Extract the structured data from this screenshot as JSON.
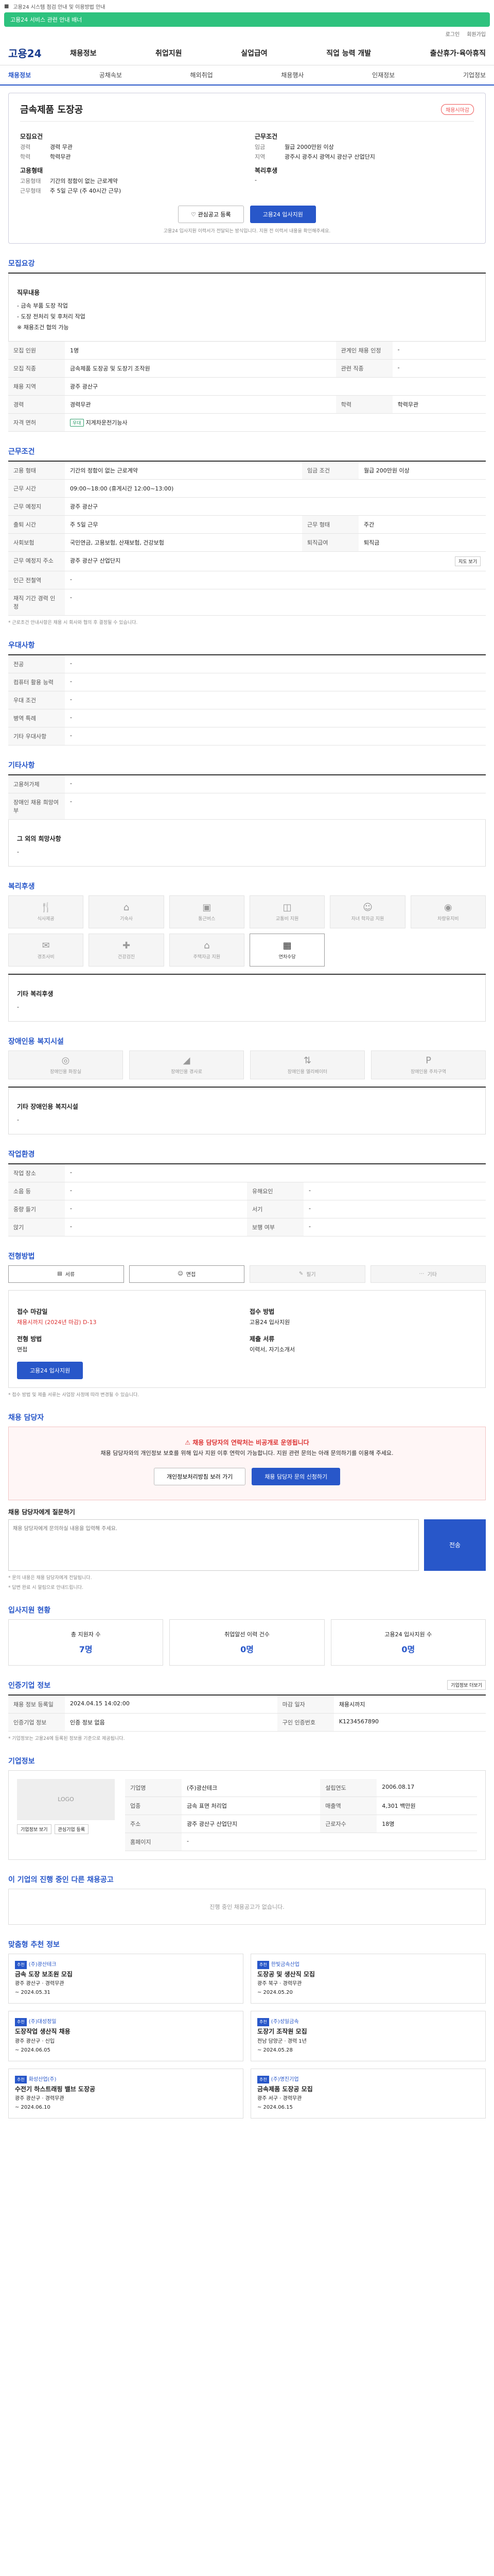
{
  "topbar": {
    "notice": "고용24 시스템 점검 안내 및 이용방법 안내"
  },
  "banner": {
    "text": "고용24 서비스 관련 안내 배너"
  },
  "util": [
    "로그인",
    "회원가입"
  ],
  "gnb": {
    "logo": "고용24",
    "menu": [
      "채용정보",
      "취업지원",
      "실업급여",
      "직업 능력 개발",
      "출산휴가·육아휴직"
    ]
  },
  "subnav": [
    "채용정보",
    "공채속보",
    "해외취업",
    "채용행사",
    "인재정보",
    "기업정보"
  ],
  "job": {
    "title": "금속제품 도장공",
    "status": "채용시마감",
    "left": [
      {
        "label": "모집요건",
        "items": [
          {
            "k": "경력",
            "v": "경력 무관"
          },
          {
            "k": "학력",
            "v": "학력무관"
          }
        ]
      },
      {
        "label": "고용형태",
        "items": [
          {
            "k": "고용형태",
            "v": "기간의 정함이 없는 근로계약"
          },
          {
            "k": "근무형태",
            "v": "주 5일 근무 (주 40시간 근무)"
          }
        ]
      }
    ],
    "right": [
      {
        "label": "근무조건",
        "items": [
          {
            "k": "임금",
            "v": "월급 2000만원 이상"
          },
          {
            "k": "지역",
            "v": "광주시 광주시 광역시 광산구 산업단지"
          }
        ]
      },
      {
        "label": "복리후생",
        "items": [
          {
            "k": "",
            "v": "-"
          }
        ]
      }
    ],
    "cta_secondary": "관심공고 등록",
    "cta_primary": "고용24 입사지원",
    "note": "고용24 입사지원 이력서가 전달되는 방식입니다. 지원 전 이력서 내용을 확인해주세요."
  },
  "sections": {
    "recruit": "모집요강",
    "work": "근무조건",
    "pref": "우대사항",
    "other": "기타사항",
    "welfare": "복리후생",
    "disabled": "장애인용 복지시설",
    "office": "작업환경",
    "method": "전형방법",
    "contact": "채용 담당자",
    "history": "입사지원 현황",
    "reg": "인증기업 정보",
    "company": "기업정보",
    "same": "이 기업의 진행 중인 다른 채용공고",
    "recommend": "맞춤형 추천 정보"
  },
  "recruit": {
    "duty_label": "직무내용",
    "duty_lines": [
      "- 금속 부품 도장 작업",
      "- 도장 전처리 및 후처리 작업",
      "※ 채용조건 협의 가능"
    ],
    "rows": [
      [
        "모집 인원",
        "1명",
        "관계인 채용 인정",
        "-"
      ],
      [
        "모집 직종",
        "금속제품 도장공 및 도장기 조작원",
        "관련 직종",
        "-"
      ],
      [
        "채용 지역",
        "광주 광산구",
        "",
        ""
      ],
      [
        "경력",
        "경력무관",
        "학력",
        "학력무관"
      ],
      [
        "자격 면허",
        "지게차운전기능사",
        "",
        ""
      ]
    ],
    "license_tag": "우대"
  },
  "work": {
    "rows": [
      [
        "고용 형태",
        "기간의 정함이 없는 근로계약",
        "임금 조건",
        "월급 200만원 이상"
      ],
      [
        "근무 시간",
        "09:00~18:00 (휴게시간 12:00~13:00)",
        "",
        ""
      ],
      [
        "근무 예정지",
        "광주 광산구",
        "",
        ""
      ],
      [
        "출퇴 시간",
        "주 5일 근무",
        "근무 형태",
        "주간"
      ],
      [
        "사회보험",
        "국민연금, 고용보험, 산재보험, 건강보험",
        "퇴직급여",
        "퇴직금"
      ],
      [
        "근무 예정지 주소",
        "광주 광산구 산업단지",
        "",
        ""
      ],
      [
        "인근 전철역",
        "-",
        "",
        ""
      ],
      [
        "재직 기간 경력 인정",
        "-",
        "",
        ""
      ]
    ],
    "map_btn": "지도 보기",
    "footnote": "* 근로조건 안내사항은 채용 시 회사와 협의 후 결정될 수 있습니다."
  },
  "pref": {
    "rows": [
      [
        "전공",
        "-"
      ],
      [
        "컴퓨터 활용 능력",
        "-"
      ],
      [
        "우대 조건",
        "-"
      ],
      [
        "병역 특례",
        "-"
      ],
      [
        "기타 우대사항",
        "-"
      ]
    ]
  },
  "other": {
    "rows": [
      [
        "고용허가제",
        "-"
      ],
      [
        "장애인 채용 희망여부",
        "-"
      ]
    ],
    "extra_label": "그 외의 희망사항",
    "extra": "-"
  },
  "welfare": {
    "items": [
      "식사제공",
      "기숙사",
      "통근버스",
      "교통비 지원",
      "자녀 학자금 지원",
      "차량유지비",
      "경조사비",
      "건강검진",
      "주택자금 지원",
      "연차수당"
    ],
    "extra_label": "기타 복리후생",
    "extra": "-"
  },
  "disabled": {
    "items": [
      "장애인용 화장실",
      "장애인용 경사로",
      "장애인용 엘리베이터",
      "장애인용 주차구역"
    ],
    "extra_label": "기타 장애인용 복지시설",
    "extra": "-"
  },
  "office": {
    "rows": [
      [
        "작업 장소",
        "-",
        "",
        ""
      ],
      [
        "소음 등",
        "-",
        "유해요인",
        "-"
      ],
      [
        "중량 들기",
        "-",
        "서기",
        "-"
      ],
      [
        "앉기",
        "-",
        "보행 여부",
        "-"
      ]
    ]
  },
  "method": {
    "items": [
      "서류",
      "면접",
      "필기",
      "기타"
    ],
    "rows": [
      [
        "접수 마감일",
        "채용시까지 (2024년 마감) D-13"
      ],
      [
        "접수 방법",
        "고용24 입사지원"
      ],
      [
        "전형 방법",
        "면접"
      ],
      [
        "제출 서류",
        "이력서, 자기소개서"
      ]
    ],
    "apply_btn": "고용24 입사지원",
    "footnote": "* 접수 방법 및 제출 서류는 사업장 사정에 따라 변경될 수 있습니다."
  },
  "contact": {
    "alert_title": "채용 담당자의 연락처는 비공개로 운영됩니다",
    "alert_body": "채용 담당자와의 개인정보 보호를 위해 입사 지원 이후 연락이 가능합니다. 지원 관련 문의는 아래 문의하기를 이용해 주세요.",
    "btn1": "개인정보처리방침 보러 가기",
    "btn2": "채용 담당자 문의 신청하기",
    "ask_label": "채용 담당자에게 질문하기",
    "ask_placeholder": "채용 담당자에게 문의하실 내용을 입력해 주세요.",
    "ask_btn": "전송",
    "notes": [
      "* 문의 내용은 채용 담당자에게 전달됩니다.",
      "* 답변 완료 시 알림으로 안내드립니다."
    ]
  },
  "history": {
    "items": [
      {
        "label": "총 지원자 수",
        "value": "7명"
      },
      {
        "label": "취업알선 이력 건수",
        "value": "0명"
      },
      {
        "label": "고용24 입사지원 수",
        "value": "0명"
      }
    ]
  },
  "reg": {
    "btn": "기업정보 더보기",
    "rows": [
      [
        "채용 정보 등록일",
        "2024.04.15 14:02:00",
        "마감 일자",
        "채용시까지"
      ],
      [
        "인증기업 정보",
        "인증 정보 없음",
        "구인 인증번호",
        "K1234567890"
      ]
    ],
    "footnote": "* 기업정보는 고용24에 등록된 정보를 기준으로 제공됩니다."
  },
  "company": {
    "logo": "LOGO",
    "rows": [
      [
        "기업명",
        "(주)광산테크",
        "설립연도",
        "2006.08.17"
      ],
      [
        "업종",
        "금속 표면 처리업",
        "매출액",
        "4,301 백만원"
      ],
      [
        "주소",
        "광주 광산구 산업단지",
        "근로자수",
        "18명"
      ],
      [
        "홈페이지",
        "-",
        "",
        ""
      ]
    ],
    "btns": [
      "기업정보 보기",
      "관심기업 등록"
    ]
  },
  "same": {
    "empty": "진행 중인 채용공고가 없습니다."
  },
  "recommend": {
    "items": [
      {
        "badge": "추천",
        "company": "(주)광산테크",
        "title": "금속 도장 보조원 모집",
        "meta": "광주 광산구 · 경력무관",
        "date": "~ 2024.05.31"
      },
      {
        "badge": "추천",
        "company": "한빛금속산업",
        "title": "도장공 및 생산직 모집",
        "meta": "광주 북구 · 경력무관",
        "date": "~ 2024.05.20"
      },
      {
        "badge": "추천",
        "company": "(주)대성정밀",
        "title": "도장작업 생산직 채용",
        "meta": "광주 광산구 · 신입",
        "date": "~ 2024.06.05"
      },
      {
        "badge": "추천",
        "company": "(주)성일금속",
        "title": "도장기 조작원 모집",
        "meta": "전남 담양군 · 경력 1년",
        "date": "~ 2024.05.28"
      },
      {
        "badge": "추천",
        "company": "화성산업(주)",
        "title": "수전기 하스트래핑 밸브 도장공",
        "meta": "광주 광산구 · 경력무관",
        "date": "~ 2024.06.10"
      },
      {
        "badge": "추천",
        "company": "(주)명진기업",
        "title": "금속제품 도장공 모집",
        "meta": "광주 서구 · 경력무관",
        "date": "~ 2024.06.15"
      }
    ]
  }
}
